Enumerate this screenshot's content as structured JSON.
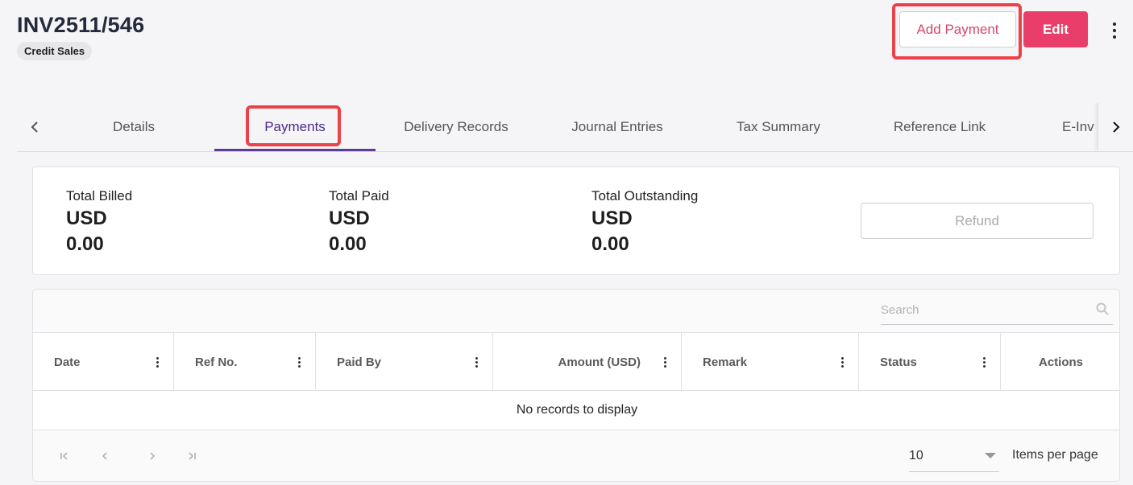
{
  "header": {
    "invoice_no": "INV2511/546",
    "type_badge": "Credit Sales",
    "add_payment_label": "Add Payment",
    "edit_label": "Edit",
    "more_icon": "vertical-ellipsis-icon"
  },
  "tabs": {
    "items": [
      {
        "label": "Details"
      },
      {
        "label": "Payments"
      },
      {
        "label": "Delivery Records"
      },
      {
        "label": "Journal Entries"
      },
      {
        "label": "Tax Summary"
      },
      {
        "label": "Reference Link"
      },
      {
        "label": "E-Inv"
      }
    ],
    "active": "Payments"
  },
  "summary": {
    "total_billed_label": "Total Billed",
    "total_billed_currency": "USD",
    "total_billed_amount": "0.00",
    "total_paid_label": "Total Paid",
    "total_paid_currency": "USD",
    "total_paid_amount": "0.00",
    "total_outstanding_label": "Total Outstanding",
    "total_outstanding_currency": "USD",
    "total_outstanding_amount": "0.00",
    "refund_label": "Refund"
  },
  "grid": {
    "search_placeholder": "Search",
    "columns": [
      "Date",
      "Ref No.",
      "Paid By",
      "Amount (USD)",
      "Remark",
      "Status",
      "Actions"
    ],
    "empty_message": "No records to display",
    "page_size": "10",
    "items_per_page_label": "Items per page"
  },
  "colors": {
    "accent": "#e93e6a",
    "active_tab": "#4b2a8a",
    "highlight": "#ec4149"
  }
}
